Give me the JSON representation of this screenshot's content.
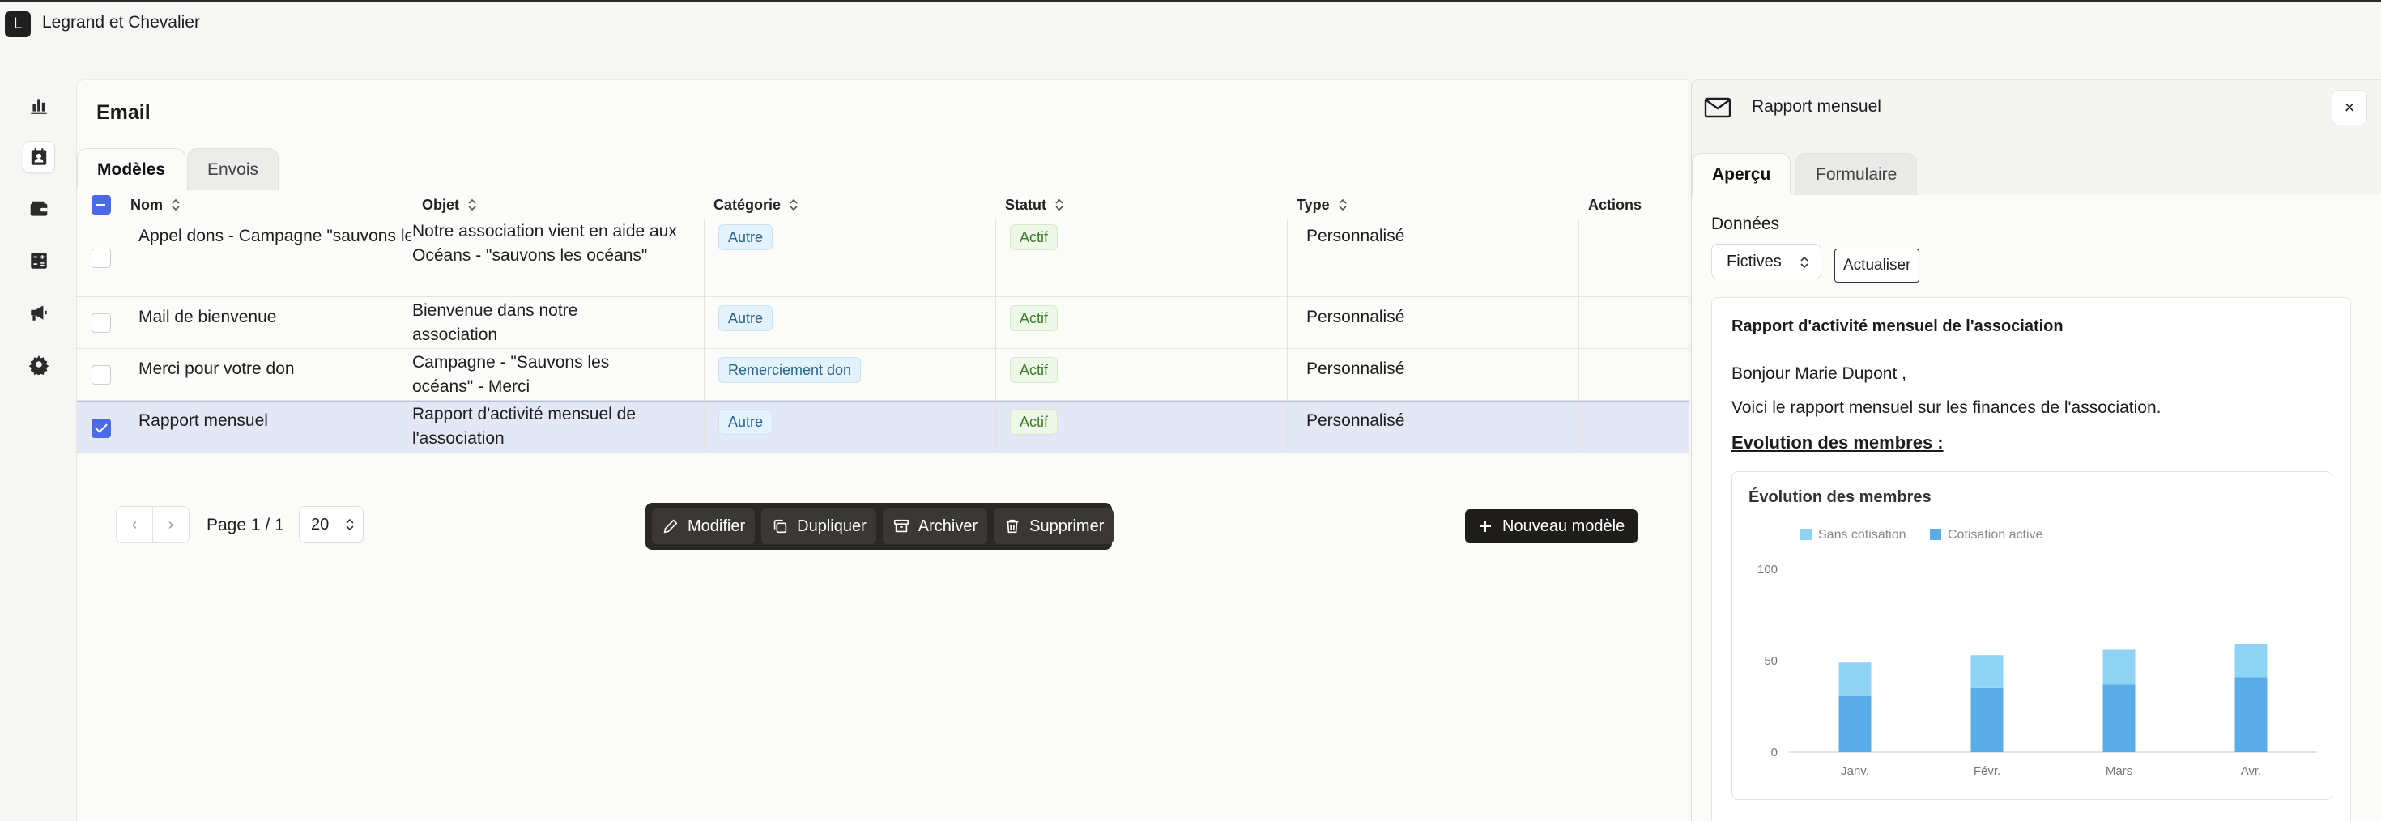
{
  "app": {
    "logo_letter": "L",
    "org_name": "Legrand et Chevalier"
  },
  "nav": [
    {
      "icon": "bar-chart-icon",
      "active": false
    },
    {
      "icon": "contacts-icon",
      "active": true
    },
    {
      "icon": "wallet-icon",
      "active": false
    },
    {
      "icon": "calculator-icon",
      "active": false
    },
    {
      "icon": "megaphone-icon",
      "active": false
    },
    {
      "icon": "gear-icon",
      "active": false
    }
  ],
  "main": {
    "title": "Email",
    "tabs": [
      {
        "label": "Modèles",
        "active": true
      },
      {
        "label": "Envois",
        "active": false
      }
    ],
    "columns": {
      "name": "Nom",
      "subject": "Objet",
      "category": "Catégorie",
      "status": "Statut",
      "type": "Type",
      "actions": "Actions"
    },
    "rows": [
      {
        "name": "Appel dons - Campagne \"sauvons les océans\"",
        "subject": "Notre association vient en aide aux Océans - \"sauvons les océans\"",
        "category": "Autre",
        "status": "Actif",
        "type": "Personnalisé",
        "selected": false
      },
      {
        "name": "Mail de bienvenue",
        "subject": "Bienvenue dans notre association",
        "category": "Autre",
        "status": "Actif",
        "type": "Personnalisé",
        "selected": false
      },
      {
        "name": "Merci pour votre don",
        "subject": "Campagne - \"Sauvons les océans\" - Merci",
        "category": "Remerciement don",
        "status": "Actif",
        "type": "Personnalisé",
        "selected": false
      },
      {
        "name": "Rapport mensuel",
        "subject": "Rapport d'activité mensuel de l'association",
        "category": "Autre",
        "status": "Actif",
        "type": "Personnalisé",
        "selected": true
      }
    ],
    "pagination": {
      "label": "Page 1 / 1",
      "page_size": "20"
    },
    "actions": {
      "edit": "Modifier",
      "duplicate": "Dupliquer",
      "archive": "Archiver",
      "delete": "Supprimer"
    },
    "new_button": "Nouveau modèle"
  },
  "panel": {
    "title": "Rapport mensuel",
    "close": "×",
    "tabs": [
      {
        "label": "Aperçu",
        "active": true
      },
      {
        "label": "Formulaire",
        "active": false
      }
    ],
    "data_label": "Données",
    "data_select": "Fictives",
    "refresh": "Actualiser",
    "preview": {
      "title": "Rapport d'activité mensuel de l'association",
      "greeting": "Bonjour Marie Dupont ,",
      "intro": "Voici le rapport mensuel sur les finances de l'association.",
      "section": "Evolution des membres :"
    }
  },
  "colors": {
    "accent": "#4a6ae8",
    "series_light": "#8fd3f4",
    "series_dark": "#5aace6"
  },
  "chart_data": {
    "type": "bar",
    "stacked": true,
    "title": "Évolution des membres",
    "categories": [
      "Janv.",
      "Févr.",
      "Mars",
      "Avr."
    ],
    "series": [
      {
        "name": "Cotisation active",
        "values": [
          31,
          35,
          37,
          41
        ],
        "color": "#5aace6"
      },
      {
        "name": "Sans cotisation",
        "values": [
          18,
          18,
          19,
          18
        ],
        "color": "#8fd3f4"
      }
    ],
    "ylim": [
      0,
      100
    ],
    "yticks": [
      0,
      50,
      100
    ],
    "legend": "top-left"
  }
}
